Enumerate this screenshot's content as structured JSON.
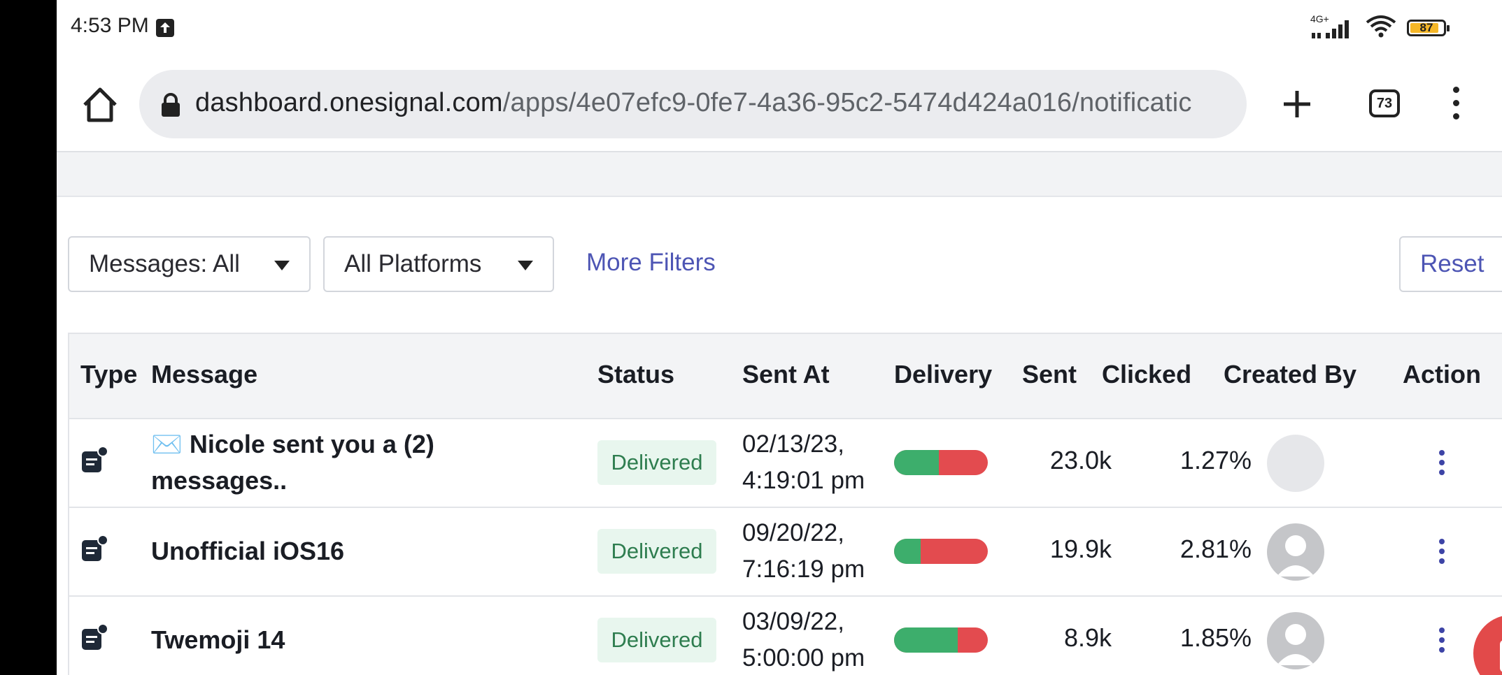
{
  "status_bar": {
    "time": "4:53 PM",
    "network": "4G+",
    "battery": "87"
  },
  "browser": {
    "url_host": "dashboard.onesignal.com",
    "url_path": "/apps/4e07efc9-0fe7-4a36-95c2-5474d424a016/notificatic",
    "tab_count": "73"
  },
  "filters": {
    "messages": "Messages: All",
    "platforms": "All Platforms",
    "more_filters": "More Filters",
    "reset": "Reset"
  },
  "table": {
    "headers": {
      "type": "Type",
      "message": "Message",
      "status": "Status",
      "sent_at": "Sent At",
      "delivery": "Delivery",
      "sent": "Sent",
      "clicked": "Clicked",
      "created_by": "Created By",
      "action": "Action"
    },
    "rows": [
      {
        "message_line1": "✉️ Nicole sent you a (2)",
        "message_line2": "messages..",
        "status": "Delivered",
        "sent_at_date": "02/13/23,",
        "sent_at_time": "4:19:01 pm",
        "delivery_success_fraction": 0.48,
        "sent": "23.0k",
        "clicked": "1.27%",
        "avatar": "blank"
      },
      {
        "message_line1": "Unofficial iOS16",
        "message_line2": "",
        "status": "Delivered",
        "sent_at_date": "09/20/22,",
        "sent_at_time": "7:16:19 pm",
        "delivery_success_fraction": 0.28,
        "sent": "19.9k",
        "clicked": "2.81%",
        "avatar": "default-user"
      },
      {
        "message_line1": "Twemoji 14",
        "message_line2": "",
        "status": "Delivered",
        "sent_at_date": "03/09/22,",
        "sent_at_time": "5:00:00 pm",
        "delivery_success_fraction": 0.68,
        "sent": "8.9k",
        "clicked": "1.85%",
        "avatar": "default-user"
      }
    ]
  },
  "colors": {
    "link": "#4d55b4",
    "delivered_badge_bg": "#e8f6ee",
    "delivery_ok": "#3dae6c",
    "delivery_fail": "#e34b4f",
    "fab": "#e24a4a"
  }
}
